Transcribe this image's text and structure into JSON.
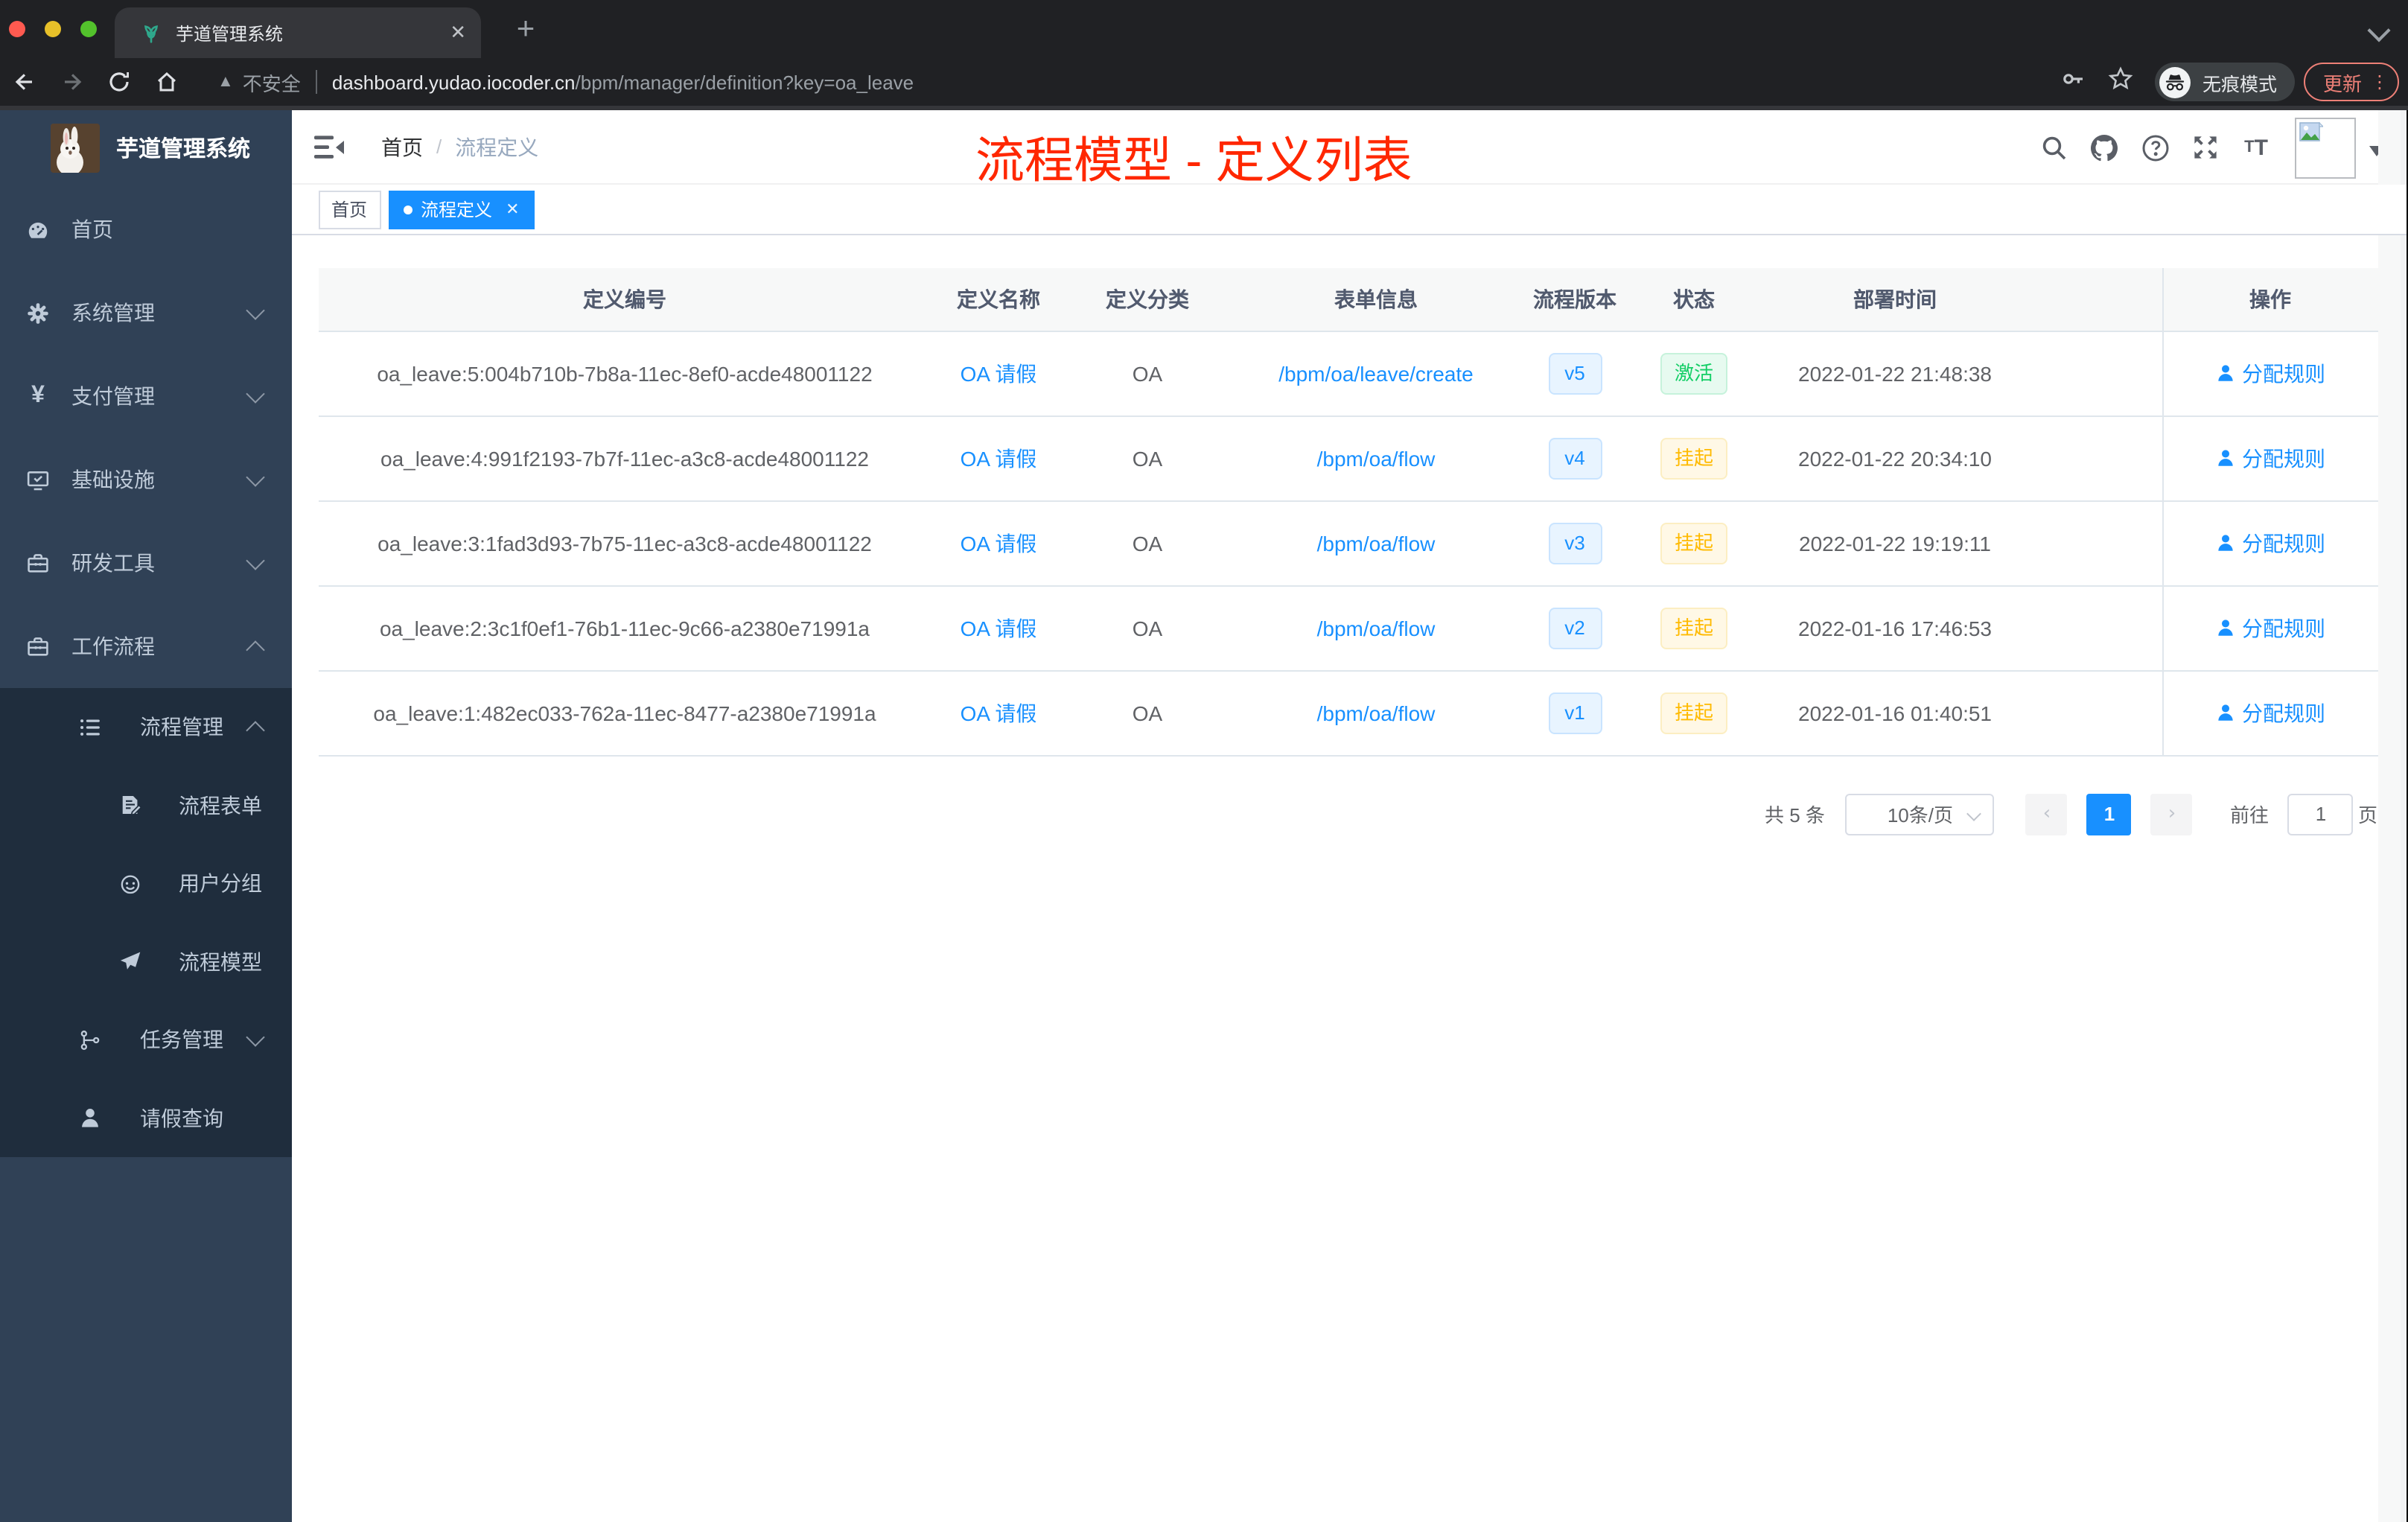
{
  "browser": {
    "tab_title": "芋道管理系统",
    "security_label": "不安全",
    "url_host": "dashboard.yudao.iocoder.cn",
    "url_path": "/bpm/manager/definition?key=oa_leave",
    "incognito_label": "无痕模式",
    "update_label": "更新"
  },
  "sidebar": {
    "logo_title": "芋道管理系统",
    "items": [
      {
        "label": "首页",
        "icon": "dashboard-icon",
        "level": 1,
        "chevron": "",
        "dark": false
      },
      {
        "label": "系统管理",
        "icon": "gear-icon",
        "level": 1,
        "chevron": "down",
        "dark": false
      },
      {
        "label": "支付管理",
        "icon": "yen-icon",
        "level": 1,
        "chevron": "down",
        "dark": false
      },
      {
        "label": "基础设施",
        "icon": "monitor-icon",
        "level": 1,
        "chevron": "down",
        "dark": false
      },
      {
        "label": "研发工具",
        "icon": "toolbox-icon",
        "level": 1,
        "chevron": "down",
        "dark": false
      },
      {
        "label": "工作流程",
        "icon": "toolbox-icon",
        "level": 1,
        "chevron": "up",
        "dark": false
      },
      {
        "label": "流程管理",
        "icon": "list-icon",
        "level": 2,
        "chevron": "up",
        "dark": true
      },
      {
        "label": "流程表单",
        "icon": "form-icon",
        "level": 3,
        "chevron": "",
        "dark": true
      },
      {
        "label": "用户分组",
        "icon": "face-icon",
        "level": 3,
        "chevron": "",
        "dark": true
      },
      {
        "label": "流程模型",
        "icon": "plane-icon",
        "level": 3,
        "chevron": "",
        "dark": true
      },
      {
        "label": "任务管理",
        "icon": "tree-icon",
        "level": 2,
        "chevron": "down",
        "dark": true
      },
      {
        "label": "请假查询",
        "icon": "person-icon",
        "level": 2,
        "chevron": "",
        "dark": true
      }
    ]
  },
  "header": {
    "breadcrumb_home": "首页",
    "breadcrumb_current": "流程定义",
    "annotation": "流程模型 - 定义列表"
  },
  "tags": [
    {
      "label": "首页",
      "active": false
    },
    {
      "label": "流程定义",
      "active": true
    }
  ],
  "table": {
    "columns": [
      "定义编号",
      "定义名称",
      "定义分类",
      "表单信息",
      "流程版本",
      "状态",
      "部署时间",
      "",
      "操作"
    ],
    "rows": [
      {
        "id": "oa_leave:5:004b710b-7b8a-11ec-8ef0-acde48001122",
        "name": "OA 请假",
        "category": "OA",
        "form": "/bpm/oa/leave/create",
        "version": "v5",
        "status": "激活",
        "status_type": "success",
        "deploy_time": "2022-01-22 21:48:38",
        "action": "分配规则"
      },
      {
        "id": "oa_leave:4:991f2193-7b7f-11ec-a3c8-acde48001122",
        "name": "OA 请假",
        "category": "OA",
        "form": "/bpm/oa/flow",
        "version": "v4",
        "status": "挂起",
        "status_type": "warning",
        "deploy_time": "2022-01-22 20:34:10",
        "action": "分配规则"
      },
      {
        "id": "oa_leave:3:1fad3d93-7b75-11ec-a3c8-acde48001122",
        "name": "OA 请假",
        "category": "OA",
        "form": "/bpm/oa/flow",
        "version": "v3",
        "status": "挂起",
        "status_type": "warning",
        "deploy_time": "2022-01-22 19:19:11",
        "action": "分配规则"
      },
      {
        "id": "oa_leave:2:3c1f0ef1-76b1-11ec-9c66-a2380e71991a",
        "name": "OA 请假",
        "category": "OA",
        "form": "/bpm/oa/flow",
        "version": "v2",
        "status": "挂起",
        "status_type": "warning",
        "deploy_time": "2022-01-16 17:46:53",
        "action": "分配规则"
      },
      {
        "id": "oa_leave:1:482ec033-762a-11ec-8477-a2380e71991a",
        "name": "OA 请假",
        "category": "OA",
        "form": "/bpm/oa/flow",
        "version": "v1",
        "status": "挂起",
        "status_type": "warning",
        "deploy_time": "2022-01-16 01:40:51",
        "action": "分配规则"
      }
    ]
  },
  "pagination": {
    "total_label": "共 5 条",
    "page_size": "10条/页",
    "current_page": "1",
    "goto_label": "前往",
    "goto_value": "1",
    "page_unit": "页"
  },
  "colors": {
    "accent_blue": "#1890ff",
    "sidebar_bg": "#304156",
    "submenu_bg": "#1f2d3d",
    "annotation_red": "#ff2700",
    "success_green": "#13ce66",
    "warning_yellow": "#ffba00"
  }
}
